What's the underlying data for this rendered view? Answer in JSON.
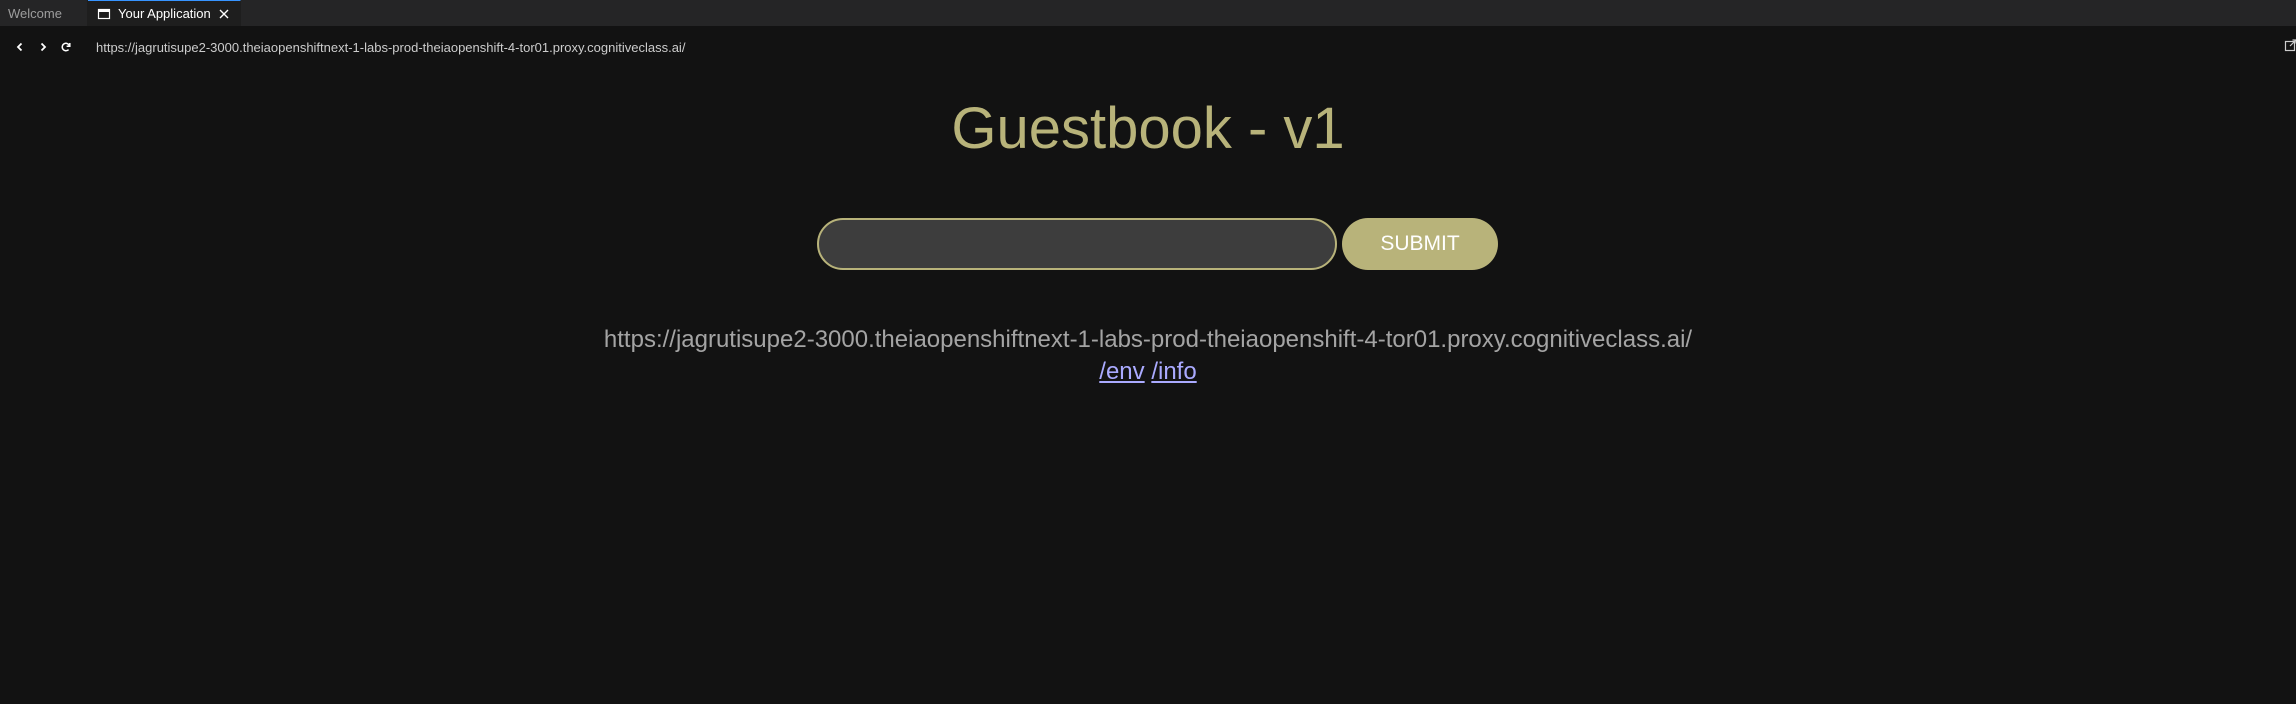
{
  "tabs": [
    {
      "label": "Welcome",
      "active": false
    },
    {
      "label": "Your Application",
      "active": true
    }
  ],
  "navbar": {
    "url": "https://jagrutisupe2-3000.theiaopenshiftnext-1-labs-prod-theiaopenshift-4-tor01.proxy.cognitiveclass.ai/",
    "icons": [
      "back-icon",
      "forward-icon",
      "reload-icon",
      "open-external-icon"
    ]
  },
  "page": {
    "title": "Guestbook - v1",
    "entry_value": "",
    "submit_label": "SUBMIT",
    "host_text": "https://jagrutisupe2-3000.theiaopenshiftnext-1-labs-prod-theiaopenshift-4-tor01.proxy.cognitiveclass.ai/",
    "env_link": "/env",
    "info_link": "/info"
  },
  "colors": {
    "accent": "#b8b37a",
    "background": "#121212",
    "link": "#aaaaff"
  }
}
